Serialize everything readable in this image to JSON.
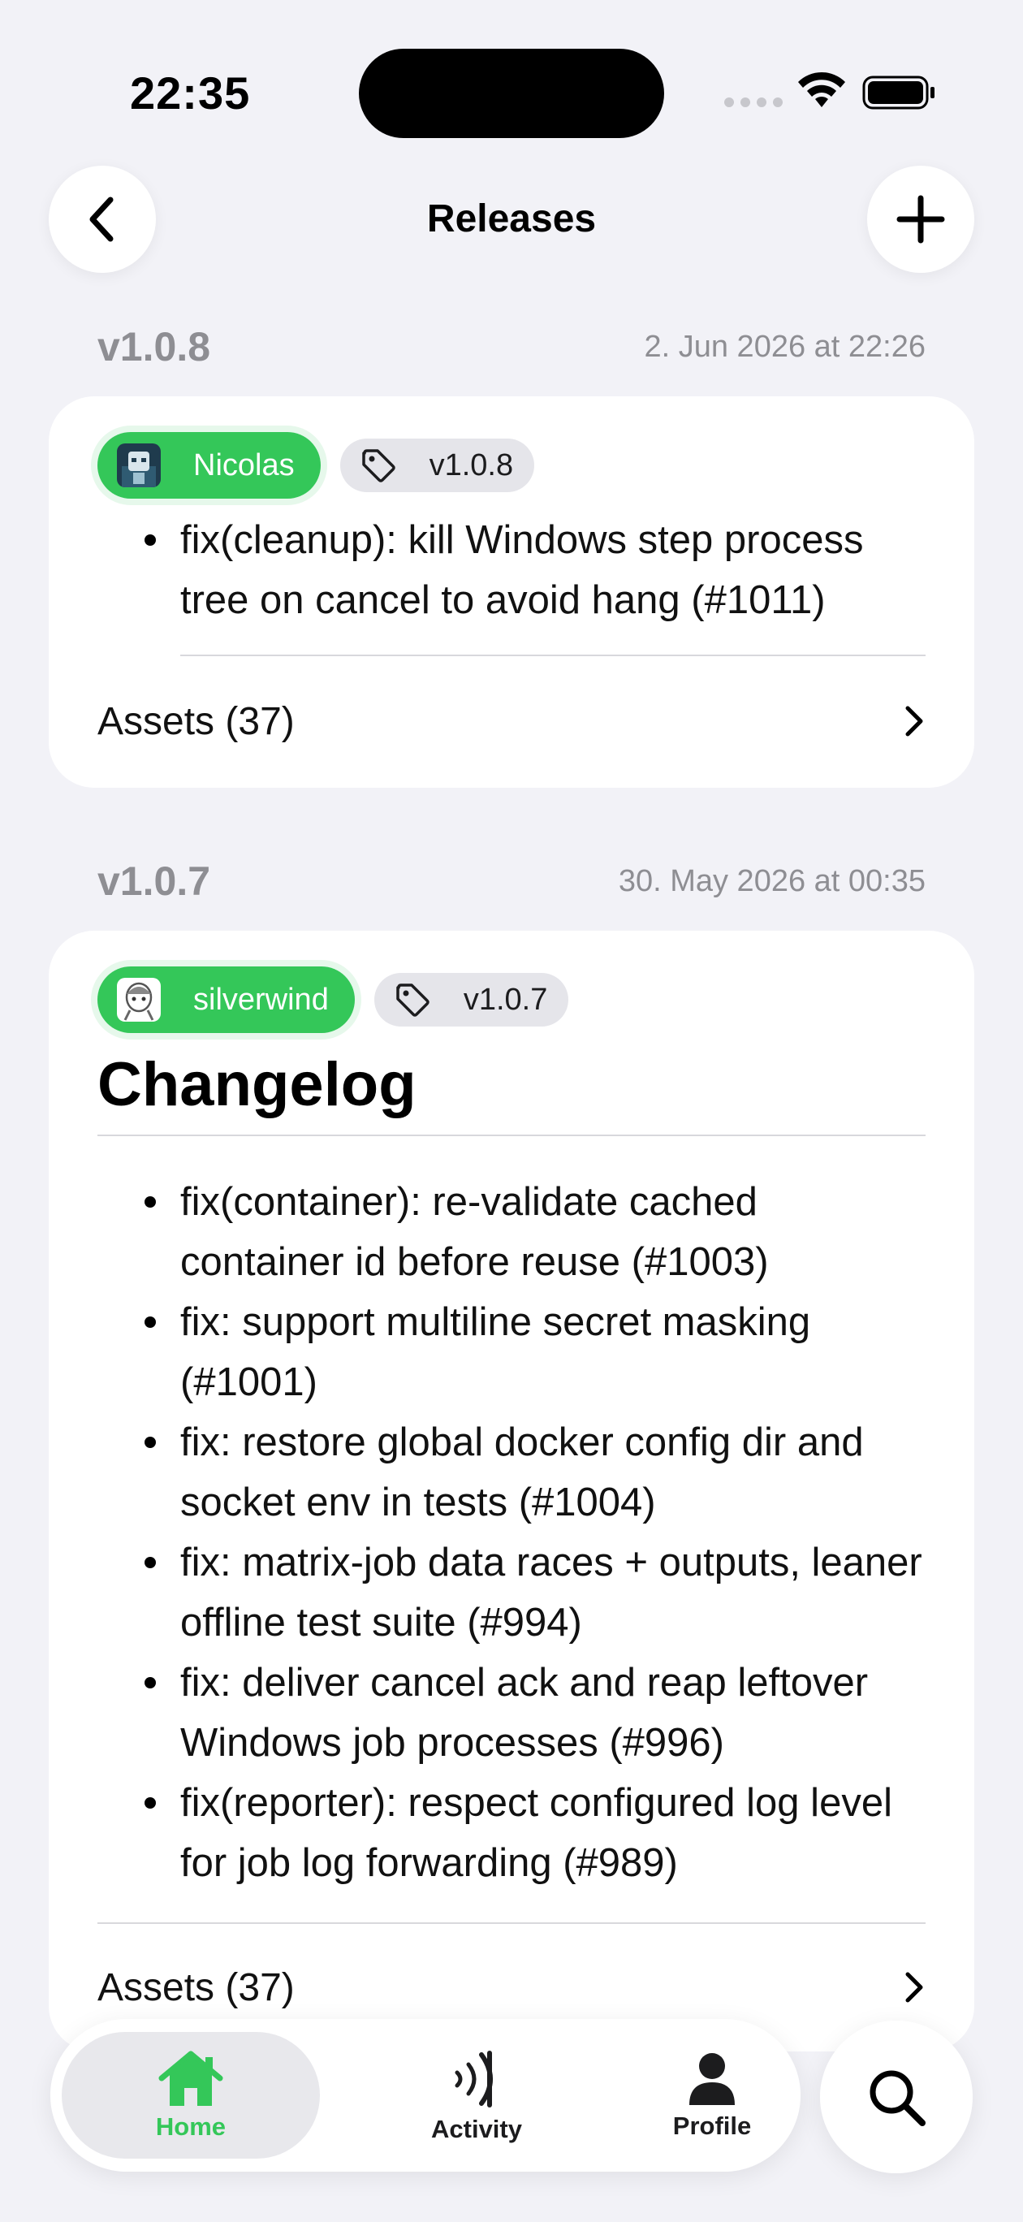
{
  "status_bar": {
    "time": "22:35"
  },
  "nav": {
    "title": "Releases"
  },
  "releases": [
    {
      "version": "v1.0.8",
      "date": "2. Jun 2026 at 22:26",
      "author": "Nicolas",
      "tag": "v1.0.8",
      "notes": [
        "fix(cleanup): kill Windows step process tree on cancel to avoid hang (#1011)"
      ],
      "assets_label": "Assets (37)"
    },
    {
      "version": "v1.0.7",
      "date": "30. May 2026 at 00:35",
      "author": "silverwind",
      "tag": "v1.0.7",
      "heading": "Changelog",
      "notes": [
        "fix(container): re-validate cached container id before reuse (#1003)",
        "fix: support multiline secret masking (#1001)",
        "fix: restore global docker config dir and socket env in tests (#1004)",
        "fix: matrix-job data races + outputs, leaner offline test suite (#994)",
        "fix: deliver cancel ack and reap leftover Windows job processes (#996)",
        "fix(reporter): respect configured log level for job log forwarding (#989)"
      ],
      "assets_label": "Assets (37)"
    }
  ],
  "tabbar": {
    "items": [
      {
        "label": "Home",
        "icon": "house-icon",
        "active": true
      },
      {
        "label": "Activity",
        "icon": "activity-icon",
        "active": false
      },
      {
        "label": "Profile",
        "icon": "person-icon",
        "active": false
      }
    ],
    "search_icon": "magnifier-icon"
  },
  "colors": {
    "accent": "#34c759",
    "background": "#f2f2f7",
    "card": "#ffffff",
    "secondary_text": "#8e8e93"
  }
}
